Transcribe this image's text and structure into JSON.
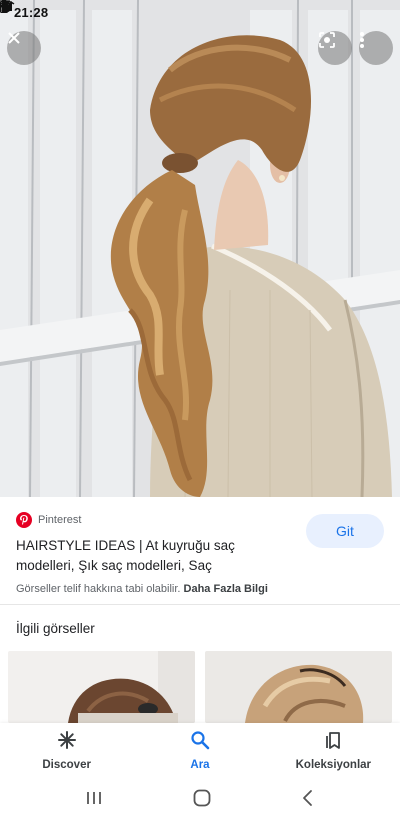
{
  "status_bar": {
    "time": "21:28",
    "left_icons": [
      "location-icon",
      "notification-icon"
    ],
    "right_icons": [
      "alarm-icon",
      "wifi-icon",
      "signal-icon",
      "battery-icon"
    ]
  },
  "viewer": {
    "close_icon": "close-icon",
    "lens_icon": "lens-icon",
    "more_icon": "more-vert-icon"
  },
  "result": {
    "source": "Pinterest",
    "title": "HAIRSTYLE IDEAS | At kuyruğu saç modelleri, Şık saç modelleri, Saç",
    "visit_label": "Git",
    "copyright_text": "Görseller telif hakkına tabi olabilir.",
    "more_info_link": "Daha Fazla Bilgi"
  },
  "related": {
    "title": "İlgili görseller"
  },
  "bottom_nav": {
    "items": [
      {
        "label": "Discover",
        "icon": "asterisk-icon",
        "active": false
      },
      {
        "label": "Ara",
        "icon": "search-icon",
        "active": true
      },
      {
        "label": "Koleksiyonlar",
        "icon": "bookmarks-icon",
        "active": false
      }
    ]
  },
  "system_nav": {
    "items": [
      "recents-icon",
      "home-icon",
      "back-icon"
    ]
  },
  "colors": {
    "accent": "#1a73e8",
    "pinterest": "#e60023",
    "visit_button_bg": "#e8f0fe"
  }
}
